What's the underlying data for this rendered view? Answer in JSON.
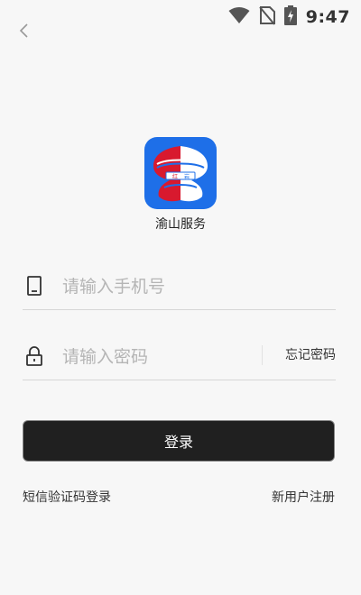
{
  "status_bar": {
    "time": "9:47"
  },
  "app": {
    "name": "渝山服务"
  },
  "phone_field": {
    "placeholder": "请输入手机号"
  },
  "password_field": {
    "placeholder": "请输入密码",
    "forgot_label": "忘记密码"
  },
  "login_button": {
    "label": "登录"
  },
  "links": {
    "sms_login": "短信验证码登录",
    "register": "新用户注册"
  },
  "colors": {
    "background": "#f7f7f7",
    "logo_blue": "#1e6fe8",
    "logo_red": "#d8192e",
    "button": "#202020"
  }
}
